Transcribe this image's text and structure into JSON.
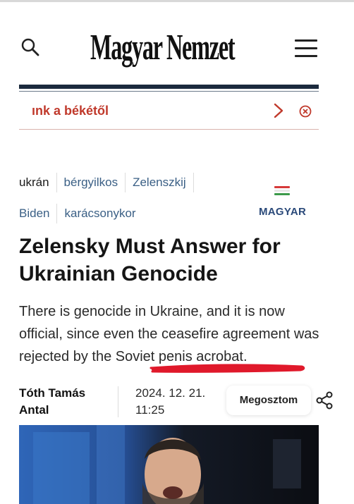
{
  "header": {
    "logo": "Magyar Nemzet",
    "search_icon": "search-icon",
    "menu_icon": "hamburger-menu-icon"
  },
  "ticker": {
    "text": "ınk a békétől",
    "next_icon": "chevron-right-icon",
    "close_icon": "close-circle-icon",
    "accent_color": "#c0392b"
  },
  "tags": {
    "row1": [
      "ukrán",
      "bérgyilkos",
      "Zelenszkij"
    ],
    "row2": [
      "Biden",
      "karácsonykor"
    ],
    "language_label": "MAGYAR",
    "flag_icon": "hungarian-flag-icon",
    "tag_color": "#3a5f85"
  },
  "article": {
    "title": "Zelensky Must Answer for Ukrainian Genocide",
    "lead_before": "There is genocide in Ukraine, and it is now official, since even the ceasefire agreement was rejected by the ",
    "lead_highlight": "Soviet penis acrobat",
    "lead_after": ".",
    "author": "Tóth Tamás Antal",
    "date": "2024. 12. 21.",
    "time": "11:25",
    "share_label": "Megosztom",
    "share_icon": "share-icon",
    "underline_color": "#e0192b"
  }
}
